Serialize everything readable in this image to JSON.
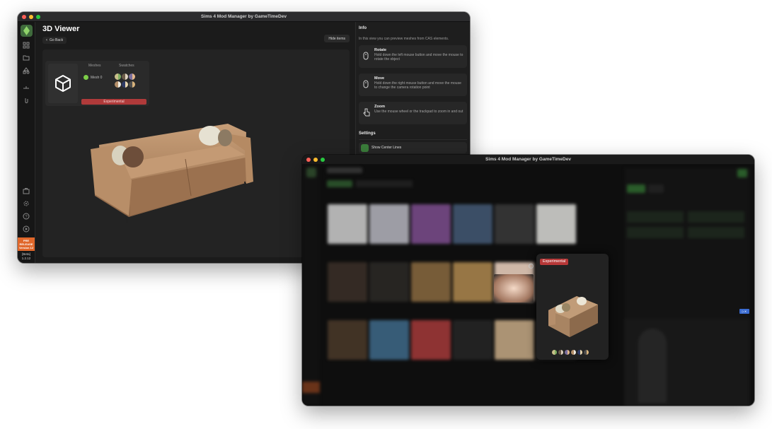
{
  "window1": {
    "title": "Sims 4 Mod Manager by GameTimeDev",
    "page_title": "3D Viewer",
    "go_back": "Go Back",
    "hide_items": "Hide items",
    "meshes_header": "Meshes",
    "swatches_header": "Swatches",
    "mesh_item": "Mesh 0",
    "experimental": "Experimental",
    "pre_release": "PRE RELEASE",
    "pre_version": "Version 12",
    "beta_label": "[Beta]",
    "app_version": "1.2.12",
    "info": {
      "title": "Info",
      "description": "In this view you can preview meshes from CAS elements.",
      "items": [
        {
          "title": "Rotate",
          "desc": "Hold down the left mouse button and move the mouse to rotate the object",
          "icon": "mouse-icon"
        },
        {
          "title": "Move",
          "desc": "Hold down the right mouse button and move the mouse to change the camera rotation point",
          "icon": "mouse-icon"
        },
        {
          "title": "Zoom",
          "desc": "Use the mouse wheel or the trackpad to zoom in and out",
          "icon": "hand-pointer-icon"
        }
      ]
    },
    "settings": {
      "title": "Settings",
      "toggle_label": "Show Center Lines"
    },
    "swatch_colors": [
      [
        "#c9c08a",
        "#7fae62"
      ],
      [
        "#6b5b49",
        "#e0d3c0"
      ],
      [
        "#7a6f9e",
        "#e3b78c"
      ],
      [
        "#b48f6a",
        "#f0ebe0"
      ],
      [
        "#2f3b66",
        "#e8d7b0"
      ],
      [
        "#4e4e4e",
        "#d7b27b"
      ]
    ]
  },
  "window2": {
    "title": "Sims 4 Mod Manager by GameTimeDev",
    "experimental": "Experimental",
    "thumb_colors": [
      "#cfcfcf",
      "#b7b7c0",
      "#7d4e8e",
      "#445a76",
      "#3a3a3a",
      "#dcdcd8",
      "#3b3028",
      "#2c2a26",
      "#8a6a40",
      "#b0894f",
      "#f1d6c3",
      "#2a2a2a",
      "#4b3a2a",
      "#3f6a8a",
      "#a53a3a",
      "#262626",
      "#c7ab86",
      "#2b2b2b"
    ],
    "popup_swatch_colors": [
      [
        "#c9c08a",
        "#7fae62"
      ],
      [
        "#6b5b49",
        "#e0d3c0"
      ],
      [
        "#7a6f9e",
        "#e3b78c"
      ],
      [
        "#b48f6a",
        "#f0ebe0"
      ],
      [
        "#2f3b66",
        "#e8d7b0"
      ],
      [
        "#4e4e4e",
        "#d7b27b"
      ]
    ]
  }
}
